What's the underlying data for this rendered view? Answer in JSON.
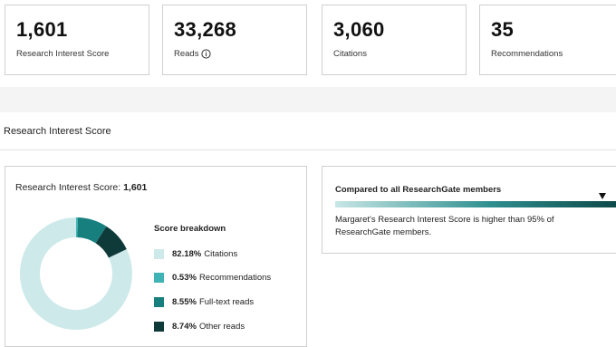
{
  "stats": [
    {
      "value": "1,601",
      "label": "Research Interest Score",
      "info": false
    },
    {
      "value": "33,268",
      "label": "Reads",
      "info": true
    },
    {
      "value": "3,060",
      "label": "Citations",
      "info": false
    },
    {
      "value": "35",
      "label": "Recommendations",
      "info": false
    }
  ],
  "section_title": "Research Interest Score",
  "score_card": {
    "title_prefix": "Research Interest Score:",
    "title_value": "1,601",
    "breakdown_title": "Score breakdown",
    "items": [
      {
        "percent": "82.18%",
        "label": "Citations",
        "value": 82.18,
        "color": "#cde9ea"
      },
      {
        "percent": "0.53%",
        "label": "Recommendations",
        "value": 0.53,
        "color": "#3fb3b5"
      },
      {
        "percent": "8.55%",
        "label": "Full-text reads",
        "value": 8.55,
        "color": "#17807f"
      },
      {
        "percent": "8.74%",
        "label": "Other reads",
        "value": 8.74,
        "color": "#0f3a3a"
      }
    ]
  },
  "compare": {
    "title": "Compared to all ResearchGate members",
    "text": "Margaret's Research Interest Score is higher than 95% of ResearchGate members.",
    "percentile": 95
  }
}
